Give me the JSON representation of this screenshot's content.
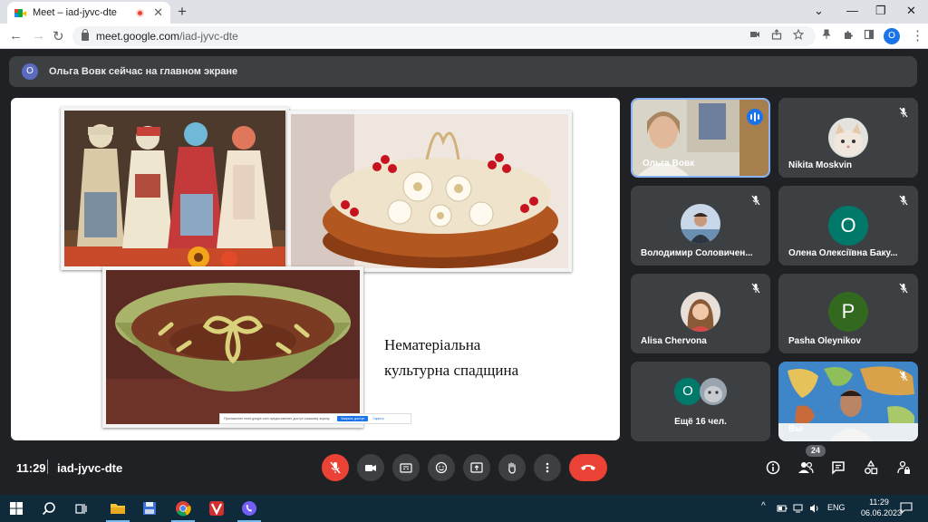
{
  "browser": {
    "tab_title": "Meet – iad-jyvc-dte",
    "tab_close": "✕",
    "new_tab": "+",
    "url_host": "meet.google.com",
    "url_path": "/iad-jyvc-dte",
    "profile_initial": "O",
    "window_controls": [
      "⌄",
      "—",
      "❐",
      "✕"
    ]
  },
  "banner": {
    "avatar_initial": "O",
    "text": "Ольга Вовк сейчас на главном экране"
  },
  "slide": {
    "title_line1": "Нематеріальна",
    "title_line2": "культурна спадщина",
    "share_bar_text": "Приложение meet.google.com предоставляет доступ к вашему экрану.",
    "share_button": "Закрыть доступ",
    "share_hide": "Скрыть"
  },
  "participants": [
    {
      "name": "Ольга Вовк",
      "muted": false,
      "speaking": true
    },
    {
      "name": "Nikita Moskvin",
      "muted": true
    },
    {
      "name": "Володимир Соловичен...",
      "muted": true
    },
    {
      "name": "Олена Олексіївна Баку...",
      "muted": true,
      "initial": "О",
      "color": "#00796b"
    },
    {
      "name": "Alisa Chervona",
      "muted": true
    },
    {
      "name": "Pasha Oleynikov",
      "muted": true,
      "initial": "P",
      "color": "#33691e"
    },
    {
      "name": "Ещё 16 чел.",
      "muted": false,
      "initial": "О",
      "color": "#00796b"
    },
    {
      "name": "Вы",
      "muted": true
    }
  ],
  "meeting": {
    "time": "11:29",
    "code": "iad-jyvc-dte",
    "people_count": "24"
  },
  "taskbar": {
    "lang": "ENG",
    "time": "11:29",
    "date": "06.06.2023"
  },
  "colors": {
    "meet_bg": "#202124",
    "tile_bg": "#3c4043",
    "accent_blue": "#1a73e8",
    "danger_red": "#ea4335"
  }
}
